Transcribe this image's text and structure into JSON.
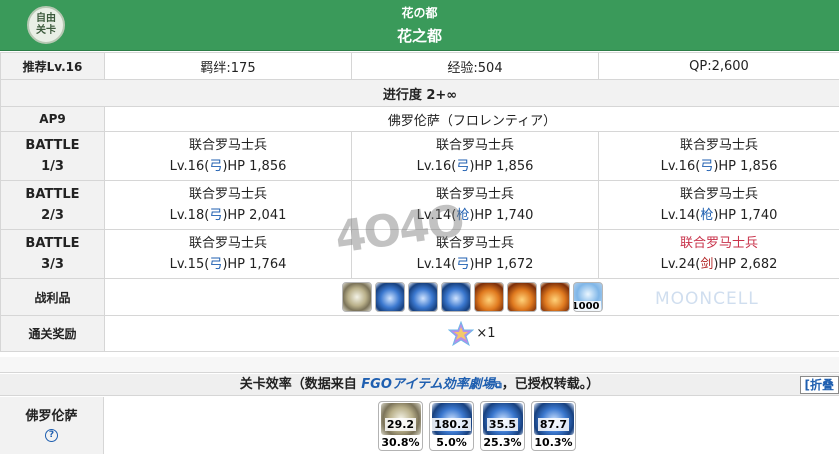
{
  "header": {
    "badge_line1": "自由",
    "badge_line2": "关卡",
    "subtitle": "花の都",
    "title": "花之都"
  },
  "recommend": {
    "level": "推荐Lv.16",
    "bond": "羁绊:175",
    "exp": "经验:504",
    "qp": "QP:2,600"
  },
  "progress": "进行度 2+∞",
  "ap": {
    "label": "AP9",
    "location": "佛罗伦萨（フロレンティア）"
  },
  "battles": [
    {
      "label_a": "BATTLE",
      "label_b": "1/3",
      "enemies": [
        {
          "name": "联合罗马士兵",
          "lv": "Lv.16(",
          "cls": "弓",
          "hp": ")HP 1,856"
        },
        {
          "name": "联合罗马士兵",
          "lv": "Lv.16(",
          "cls": "弓",
          "hp": ")HP 1,856"
        },
        {
          "name": "联合罗马士兵",
          "lv": "Lv.16(",
          "cls": "弓",
          "hp": ")HP 1,856"
        }
      ]
    },
    {
      "label_a": "BATTLE",
      "label_b": "2/3",
      "enemies": [
        {
          "name": "联合罗马士兵",
          "lv": "Lv.18(",
          "cls": "弓",
          "hp": ")HP 2,041"
        },
        {
          "name": "联合罗马士兵",
          "lv": "Lv.14(",
          "cls": "枪",
          "hp": ")HP 1,740"
        },
        {
          "name": "联合罗马士兵",
          "lv": "Lv.14(",
          "cls": "枪",
          "hp": ")HP 1,740"
        }
      ]
    },
    {
      "label_a": "BATTLE",
      "label_b": "3/3",
      "enemies": [
        {
          "name": "联合罗马士兵",
          "lv": "Lv.15(",
          "cls": "弓",
          "hp": ")HP 1,764"
        },
        {
          "name": "联合罗马士兵",
          "lv": "Lv.14(",
          "cls": "弓",
          "hp": ")HP 1,672"
        },
        {
          "name": "联合罗马士兵",
          "lv": "Lv.24(",
          "cls": "剑",
          "hp": ")HP 2,682"
        }
      ]
    }
  ],
  "loot": {
    "label": "战利品",
    "qp_count": "1000",
    "icons": [
      "disk-icon",
      "blue-gem-icon",
      "blue-gem-icon",
      "blue-gem-icon",
      "fire-icon",
      "fire-icon",
      "fire-icon",
      "crystal-icon"
    ]
  },
  "clear": {
    "label": "通关奖励",
    "count": "×1"
  },
  "efficiency": {
    "title_prefix": "关卡效率（数据来自 ",
    "link": "FGOアイテム効率劇場",
    "title_suffix": "，已授权转载。）",
    "fold": "[折叠",
    "location_label": "佛罗伦萨",
    "help": "?",
    "items": [
      {
        "ap_per": "29.2",
        "rate": "30.8%"
      },
      {
        "ap_per": "180.2",
        "rate": "5.0%"
      },
      {
        "ap_per": "35.5",
        "rate": "25.3%"
      },
      {
        "ap_per": "87.7",
        "rate": "10.3%"
      }
    ]
  },
  "watermark": {
    "logo": "4O4O",
    "brand": "MOONCELL"
  },
  "colors": {
    "header": "#3a9a5a",
    "class_blue": "#1f5fb0",
    "enemy_red": "#c8324a"
  }
}
